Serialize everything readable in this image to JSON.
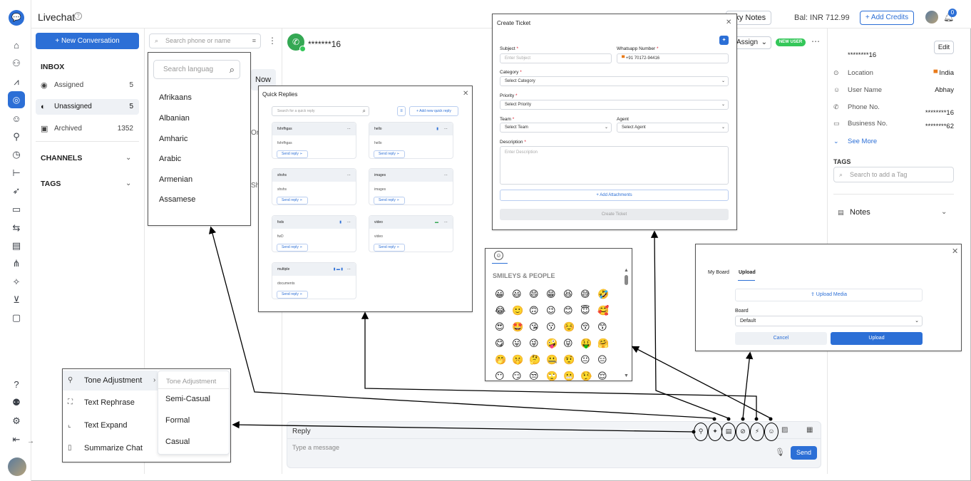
{
  "app": {
    "title": "Livechat",
    "help": "?",
    "sticky": "cky Notes",
    "balance": "Bal: INR 712.99",
    "add_credits": "+ Add Credits",
    "notifications": "0"
  },
  "inbox": {
    "new_conversation": "New Conversation",
    "section": "INBOX",
    "items": [
      {
        "label": "Assigned",
        "count": "5"
      },
      {
        "label": "Unassigned",
        "count": "5"
      },
      {
        "label": "Archived",
        "count": "1352"
      }
    ],
    "channels": "CHANNELS",
    "tags": "TAGS"
  },
  "list": {
    "search_placeholder": "Search phone or name",
    "now": "Now",
    "frag1": "Or",
    "frag2": "Sh"
  },
  "chat": {
    "name": "*******16",
    "assign": "Assign",
    "new_user": "NEW USER"
  },
  "contact": {
    "edit": "Edit",
    "phone_masked": "********16",
    "fields": [
      {
        "label": "Location",
        "value": "India",
        "icon": "pin-icon"
      },
      {
        "label": "User Name",
        "value": "Abhay",
        "icon": "user-icon"
      },
      {
        "label": "Phone No.",
        "value": "********16",
        "icon": "phone-icon"
      },
      {
        "label": "Business No.",
        "value": "********62",
        "icon": "briefcase-icon"
      }
    ],
    "see_more": "See More",
    "tags_title": "TAGS",
    "tag_placeholder": "Search to add a Tag",
    "notes": "Notes"
  },
  "composer": {
    "reply": "Reply",
    "placeholder": "Type a message",
    "send": "Send"
  },
  "language_popup": {
    "placeholder": "Search languag",
    "languages": [
      "Afrikaans",
      "Albanian",
      "Amharic",
      "Arabic",
      "Armenian",
      "Assamese"
    ]
  },
  "quick_replies": {
    "title": "Quick Replies",
    "search_placeholder": "Search for a quick reply",
    "add": "+ Add new quick reply",
    "send": "Send reply",
    "cards": [
      {
        "title": "fshrfhgas",
        "body": "fshrfhgas"
      },
      {
        "title": "hello",
        "body": "hello"
      },
      {
        "title": "shshs",
        "body": "shshs"
      },
      {
        "title": "images",
        "body": "images"
      },
      {
        "title": "fsds",
        "body": "fwD"
      },
      {
        "title": "video",
        "body": "video"
      },
      {
        "title": "multiple",
        "body": "documents"
      }
    ]
  },
  "ticket": {
    "title": "Create Ticket",
    "subject": "Subject",
    "subject_ph": "Enter Subject",
    "whatsapp": "Whatsapp Number",
    "phone": "+91 70172-94416",
    "category": "Category",
    "category_ph": "Select Category",
    "priority": "Priority",
    "priority_ph": "Select Priority",
    "team": "Team",
    "team_ph": "Select Team",
    "agent": "Agent",
    "agent_ph": "Select Agent",
    "description": "Description",
    "description_ph": "Enter Description",
    "attach": "+ Add Attachments",
    "create": "Create Ticket",
    "required": "*"
  },
  "emoji": {
    "category": "SMILEYS & PEOPLE",
    "rows": [
      [
        "😀",
        "😃",
        "😄",
        "😁",
        "😆",
        "😅",
        "🤣"
      ],
      [
        "😂",
        "🙂",
        "🙃",
        "😉",
        "😊",
        "😇",
        "🥰"
      ],
      [
        "😍",
        "🤩",
        "😘",
        "😗",
        "☺️",
        "😚",
        "😙"
      ],
      [
        "😋",
        "😛",
        "😜",
        "🤪",
        "😝",
        "🤑",
        "🤗"
      ],
      [
        "🤭",
        "🤫",
        "🤔",
        "🤐",
        "🤨",
        "😐",
        "😑"
      ],
      [
        "😶",
        "😏",
        "😒",
        "🙄",
        "😬",
        "🤥",
        "😌"
      ]
    ]
  },
  "upload": {
    "tab1": "My Board",
    "tab2": "Upload",
    "upload_media": "Upload Media",
    "board": "Board",
    "board_value": "Default",
    "cancel": "Cancel",
    "upload": "Upload"
  },
  "ai_menu": {
    "items": [
      "Tone Adjustment",
      "Text Rephrase",
      "Text Expand",
      "Summarize Chat"
    ],
    "sub_title": "Tone Adjustment",
    "tones": [
      "Semi-Casual",
      "Formal",
      "Casual"
    ]
  },
  "colors": {
    "accent": "#2c6fd6",
    "green": "#34c759"
  }
}
